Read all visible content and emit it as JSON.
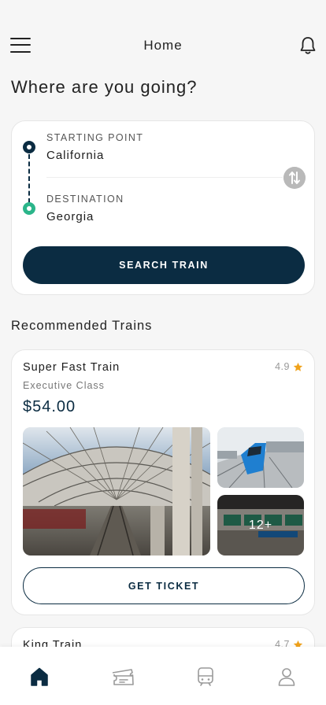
{
  "header": {
    "title": "Home",
    "menu_icon": "hamburger-menu-icon",
    "notification_icon": "bell-icon"
  },
  "page_heading": "Where are you going?",
  "route": {
    "start_label": "STARTING POINT",
    "start_value": "California",
    "destination_label": "DESTINATION",
    "destination_value": "Georgia",
    "swap_icon": "swap-vertical-icon",
    "search_button": "SEARCH TRAIN"
  },
  "recommended": {
    "heading": "Recommended Trains",
    "trains": [
      {
        "name": "Super Fast Train",
        "rating": "4.9",
        "class": "Executive Class",
        "price": "$54.00",
        "more_photos": "12+",
        "button": "GET TICKET"
      },
      {
        "name": "King Train",
        "rating": "4.7"
      }
    ]
  },
  "bottom_nav": [
    {
      "icon": "home-icon",
      "active": true
    },
    {
      "icon": "ticket-icon",
      "active": false
    },
    {
      "icon": "train-icon",
      "active": false
    },
    {
      "icon": "profile-icon",
      "active": false
    }
  ],
  "colors": {
    "primary": "#0b2c42",
    "accent_green": "#2bb58a",
    "star": "#f0a21b",
    "background": "#f6f6f6"
  }
}
